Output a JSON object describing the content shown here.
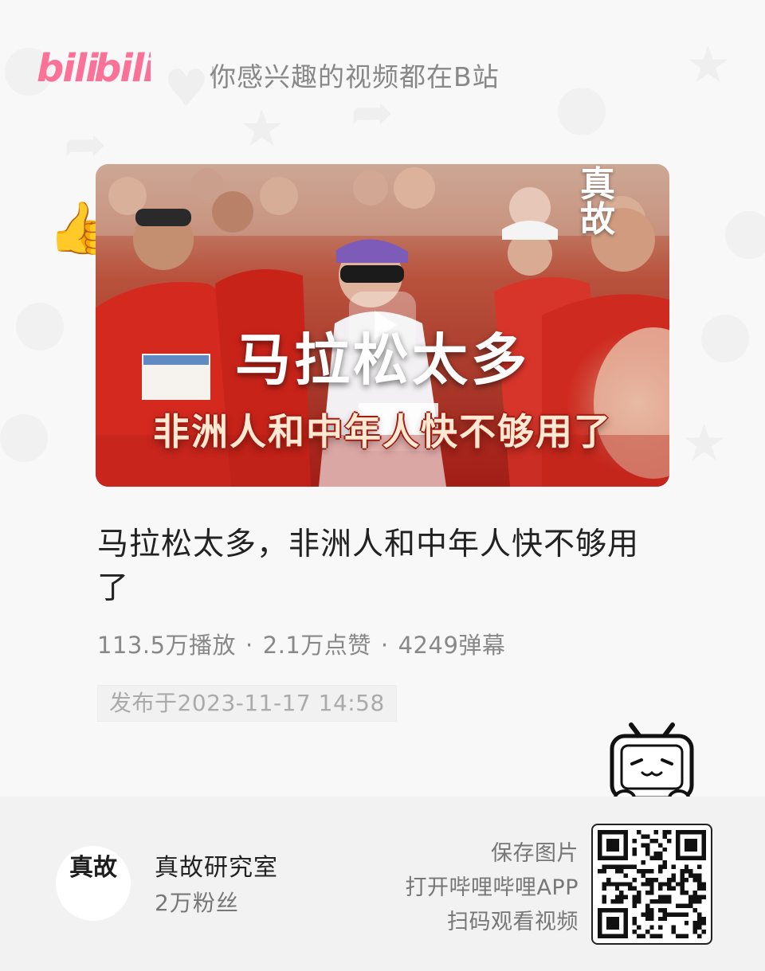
{
  "header": {
    "logo_text": "bilibili",
    "slogan": "你感兴趣的视频都在B站"
  },
  "cover": {
    "title": "马拉松太多",
    "subtitle": "非洲人和中年人快不够用了",
    "badge_text": "真故"
  },
  "video": {
    "title": "马拉松太多，非洲人和中年人快不够用了",
    "views": "113.5万播放",
    "likes": "2.1万点赞",
    "danmaku": "4249弹幕",
    "separator": "·",
    "publish_time": "发布于2023-11-17 14:58"
  },
  "uploader": {
    "avatar_text": "真故",
    "name": "真故研究室",
    "fans": "2万粉丝"
  },
  "cta": {
    "line1": "保存图片",
    "line2": "打开哔哩哔哩APP",
    "line3": "扫码观看视频"
  },
  "colors": {
    "brand_pink": "#fb7299",
    "footer_bg": "#f2f2f2",
    "cover_red": "#d8352a"
  },
  "icons": {
    "mascot": "bilibili-tv-mascot-icon",
    "qr": "qr-code-icon",
    "play": "play-icon"
  }
}
